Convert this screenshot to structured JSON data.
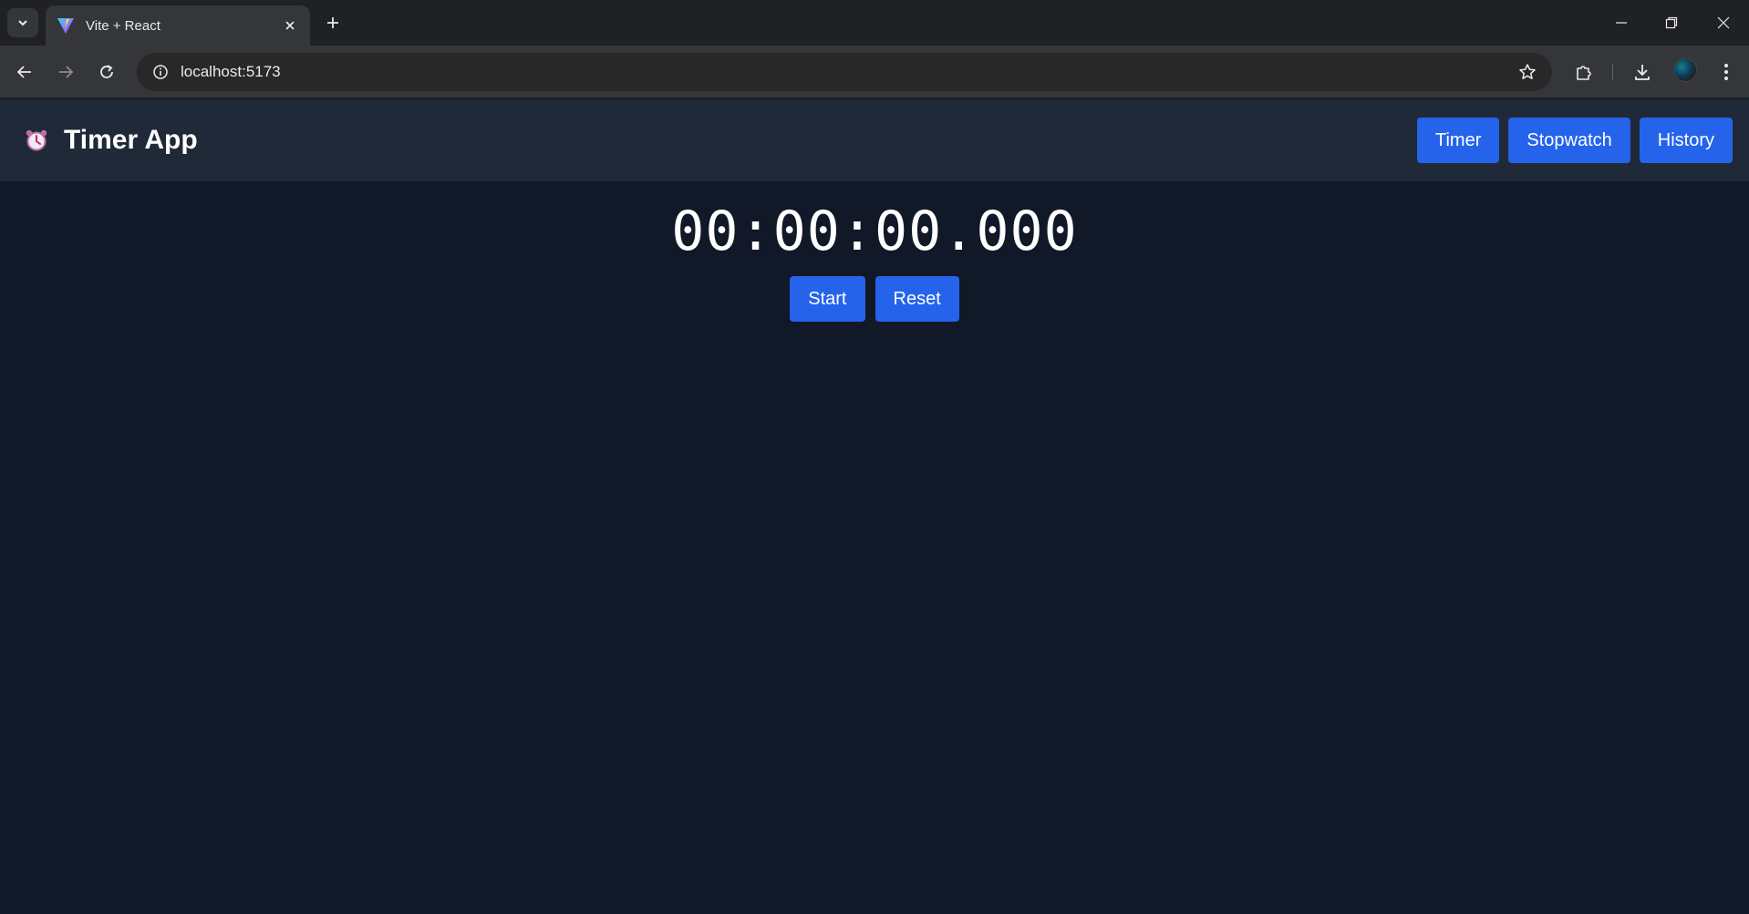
{
  "browser": {
    "tab": {
      "title": "Vite + React"
    },
    "address": {
      "url": "localhost:5173"
    }
  },
  "app": {
    "title": "Timer App",
    "nav": [
      {
        "label": "Timer"
      },
      {
        "label": "Stopwatch"
      },
      {
        "label": "History"
      }
    ],
    "stopwatch": {
      "display": "00:00:00.000",
      "start_label": "Start",
      "reset_label": "Reset"
    }
  },
  "colors": {
    "page_bg": "#111827",
    "header_bg": "#1f2937",
    "accent": "#2563eb"
  }
}
